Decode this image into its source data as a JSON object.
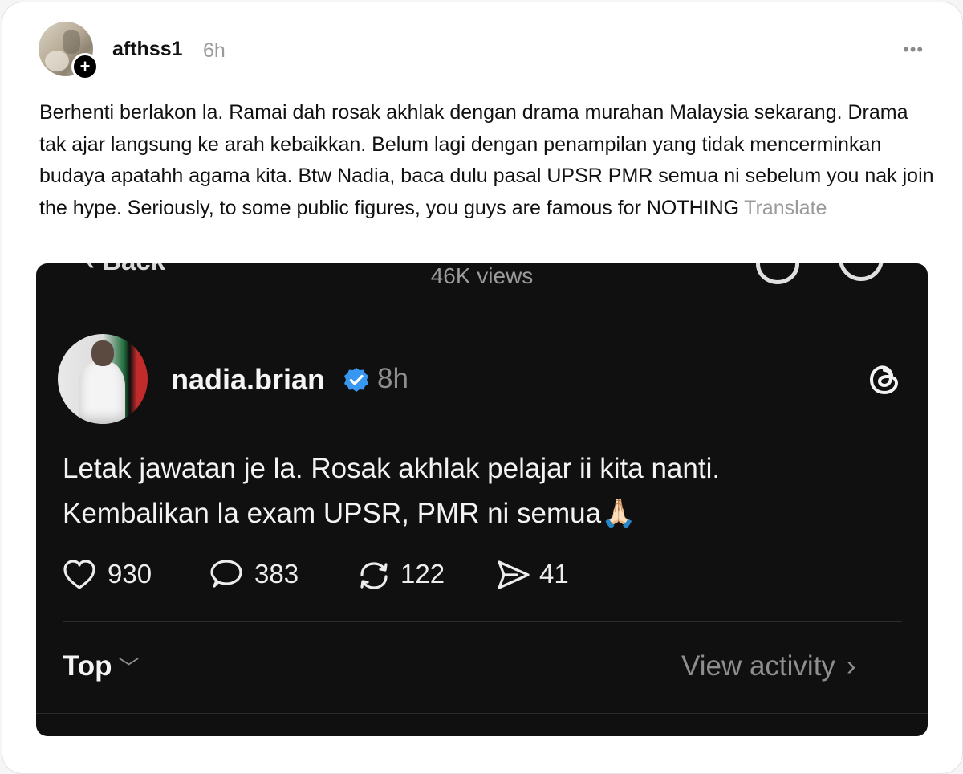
{
  "post": {
    "username": "afthss1",
    "time": "6h",
    "more_icon": "ellipsis-icon",
    "follow_icon": "plus-icon",
    "caption": "Berhenti berlakon la. Ramai dah rosak akhlak dengan drama murahan Malaysia sekarang. Drama tak ajar langsung ke arah kebaikkan. Belum lagi dengan penampilan yang tidak mencerminkan budaya apatahh agama kita. Btw Nadia, baca dulu pasal UPSR PMR semua ni sebelum you nak join the hype. Seriously, to some public figures, you guys are famous for NOTHING",
    "translate_label": "Translate"
  },
  "screenshot": {
    "back_label": "Back",
    "views": "46K views",
    "author": "nadia.brian",
    "time": "8h",
    "verified_color": "#3897f0",
    "text_line1": "Letak jawatan je la. Rosak akhlak pelajar ii kita nanti.",
    "text_line2": "Kembalikan la exam UPSR, PMR ni semua",
    "emoji": "🙏🏻",
    "likes": "930",
    "replies": "383",
    "reposts": "122",
    "shares": "41",
    "sort_label": "Top",
    "view_activity_label": "View activity"
  }
}
